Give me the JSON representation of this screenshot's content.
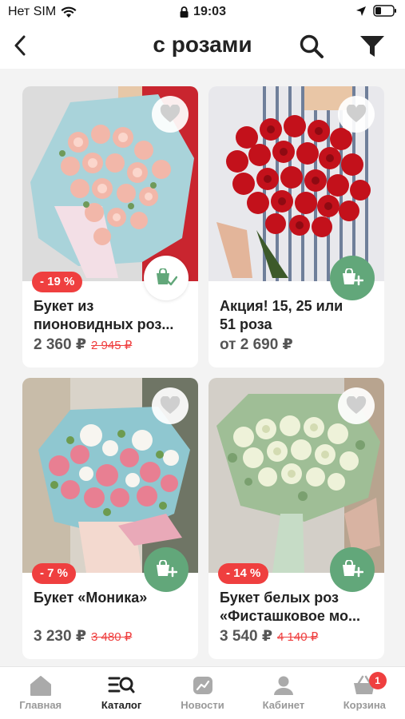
{
  "status_bar": {
    "carrier": "Нет SIM",
    "time": "19:03"
  },
  "nav": {
    "title": "с розами"
  },
  "products": [
    {
      "name": "Букет из\nпионовидных роз...",
      "price": "2 360 ₽",
      "old_price": "2 945 ₽",
      "discount": "- 19 %",
      "in_cart": true
    },
    {
      "name": "Акция! 15, 25 или\n51 роза",
      "price": "от 2 690 ₽",
      "old_price": "",
      "discount": "",
      "in_cart": false
    },
    {
      "name": "Букет «Моника»",
      "price": "3 230 ₽",
      "old_price": "3 480 ₽",
      "discount": "- 7 %",
      "in_cart": false
    },
    {
      "name": "Букет белых роз\n«Фисташковое мо...",
      "price": "3 540 ₽",
      "old_price": "4 140 ₽",
      "discount": "- 14 %",
      "in_cart": false
    }
  ],
  "tabs": [
    {
      "label": "Главная",
      "icon": "home-icon"
    },
    {
      "label": "Каталог",
      "icon": "catalog-icon",
      "active": true
    },
    {
      "label": "Новости",
      "icon": "news-icon"
    },
    {
      "label": "Кабинет",
      "icon": "profile-icon"
    },
    {
      "label": "Корзина",
      "icon": "basket-icon",
      "badge": "1"
    }
  ],
  "colors": {
    "accent_green": "#62a77a",
    "discount_red": "#ef3f3f"
  }
}
